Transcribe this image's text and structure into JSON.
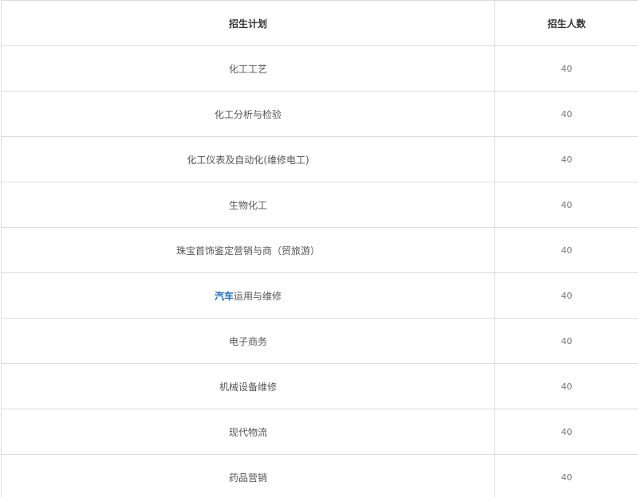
{
  "table": {
    "headers": [
      "招生计划",
      "招生人数"
    ],
    "rows": [
      {
        "plan": "化工工艺",
        "count": "40"
      },
      {
        "plan": "化工分析与检验",
        "count": "40"
      },
      {
        "plan": "化工仪表及自动化(维修电工)",
        "count": "40"
      },
      {
        "plan": "生物化工",
        "count": "40"
      },
      {
        "plan": "珠宝首饰鉴定营销与商（贸旅游）",
        "count": "40"
      },
      {
        "plan_link": "汽车",
        "plan_rest": "运用与维修",
        "count": "40"
      },
      {
        "plan": "电子商务",
        "count": "40"
      },
      {
        "plan": "机械设备维修",
        "count": "40"
      },
      {
        "plan": "现代物流",
        "count": "40"
      },
      {
        "plan": "药品营销",
        "count": "40"
      }
    ]
  },
  "colors": {
    "border": "#dcdcdc",
    "link": "#1f6fc5",
    "text": "#555555"
  }
}
